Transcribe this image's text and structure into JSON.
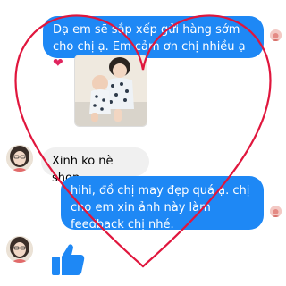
{
  "theme": {
    "accent": "#1e88f5",
    "overlay": "#e0163d"
  },
  "messages": {
    "outgoing_1": {
      "text": "Dạ em sẽ sắp xếp gửi hàng sớm cho chị ạ. Em cảm ơn chị nhiều ạ",
      "emoji": "❤"
    },
    "incoming_1": {
      "text": "Xinh ko nè shop"
    },
    "outgoing_2": {
      "text": "hihi, đồ chị may đẹp quá ạ. chị cho em xin ảnh này làm feedback chị nhé."
    }
  },
  "icons": {
    "like": "thumbs-up-icon",
    "read_receipt": "avatar-receipt-icon",
    "overlay": "heart-outline"
  }
}
